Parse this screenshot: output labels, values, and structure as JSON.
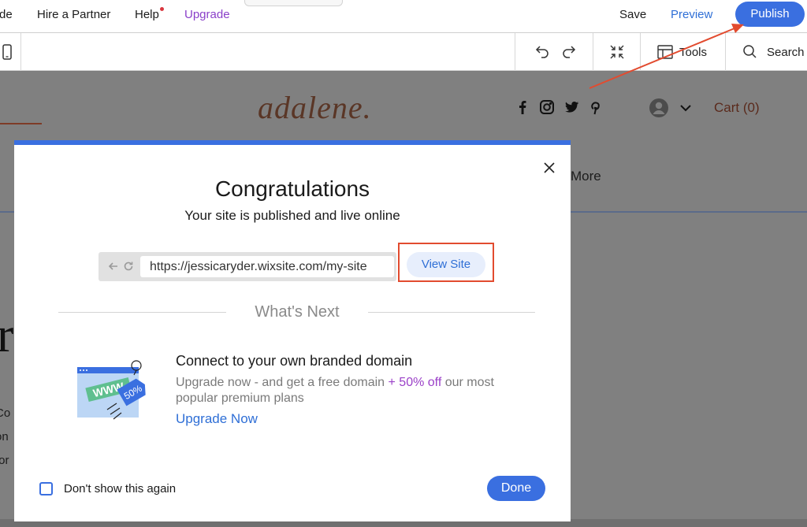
{
  "topbar": {
    "partial_left": "de",
    "hire_partner": "Hire a Partner",
    "help": "Help",
    "upgrade": "Upgrade",
    "save": "Save",
    "preview": "Preview",
    "publish": "Publish"
  },
  "toolbar": {
    "tools": "Tools",
    "search": "Search"
  },
  "site": {
    "logo": "adalene.",
    "cart": "Cart (0)",
    "more": "More",
    "big_letter": "r",
    "text_fragments": [
      "Co",
      "on",
      "for"
    ],
    "social_icons": [
      "facebook-icon",
      "instagram-icon",
      "twitter-icon",
      "pinterest-icon"
    ]
  },
  "modal": {
    "title": "Congratulations",
    "subtitle": "Your site is published and live online",
    "url": "https://jessicaryder.wixsite.com/my-site",
    "view_site": "View Site",
    "whats_next": "What's Next",
    "domain_title": "Connect to your own branded domain",
    "domain_desc_1": "Upgrade now - and get a free domain ",
    "domain_desc_promo": "+ 50% off",
    "domain_desc_2": " our most popular premium plans",
    "illustration_www": "WWW",
    "illustration_tag": "50%",
    "upgrade_link": "Upgrade Now",
    "dont_show": "Don't show this again",
    "done": "Done"
  },
  "colors": {
    "accent": "#3a6fe0",
    "annotation": "#e24b2f",
    "promo": "#9b41c8",
    "upgrade": "#8a3fc9"
  }
}
